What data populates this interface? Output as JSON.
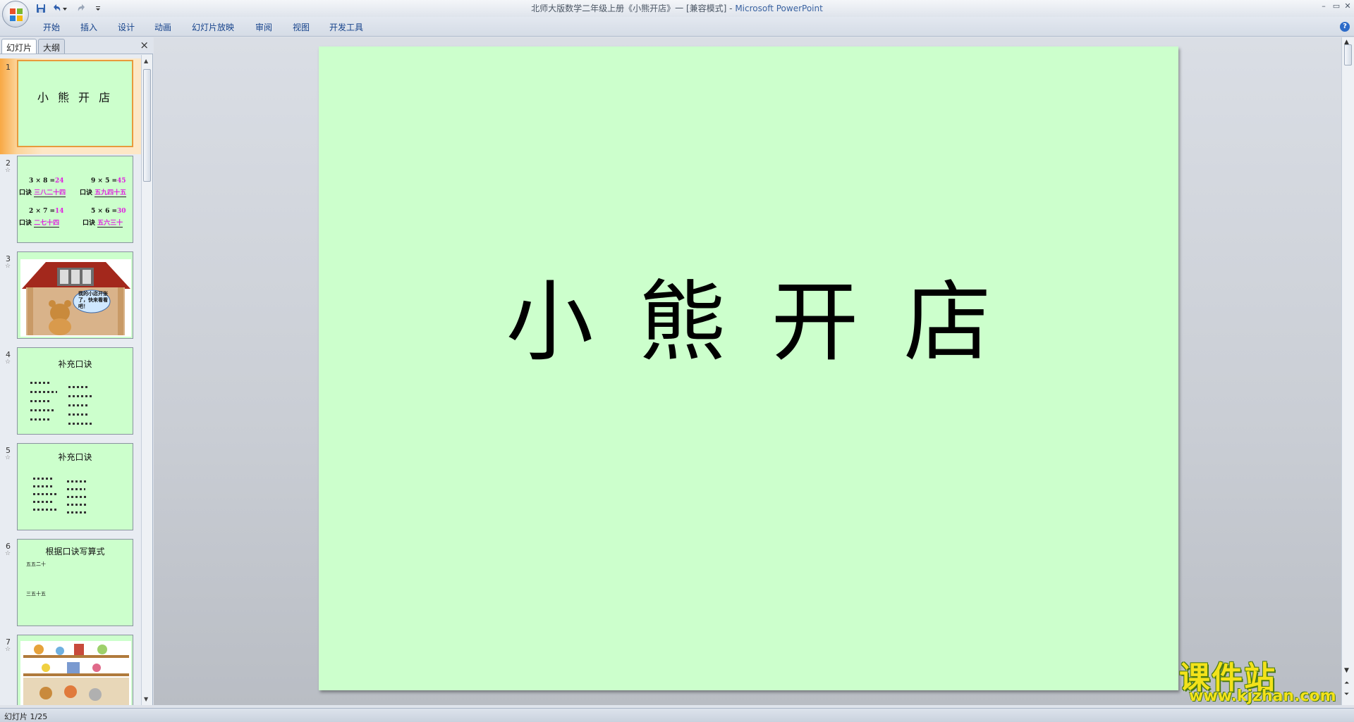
{
  "window": {
    "title_doc": "北师大版数学二年级上册《小熊开店》一 [兼容模式]",
    "title_sep": " - ",
    "title_app": "Microsoft PowerPoint"
  },
  "ribbon": {
    "tabs": [
      "开始",
      "插入",
      "设计",
      "动画",
      "幻灯片放映",
      "审阅",
      "视图",
      "开发工具"
    ]
  },
  "pane": {
    "tab_slides": "幻灯片",
    "tab_outline": "大纲",
    "close": "×"
  },
  "slides": [
    {
      "num": "1",
      "title": "小 熊 开 店"
    },
    {
      "num": "2",
      "star": "☆",
      "problems": [
        {
          "expr": "3 × 8 =",
          "ans": "24",
          "label": "口诀",
          "rhyme": "三八二十四"
        },
        {
          "expr": "9 × 5 =",
          "ans": "45",
          "label": "口诀",
          "rhyme": "五九四十五"
        },
        {
          "expr": "2 × 7 =",
          "ans": "14",
          "label": "口诀",
          "rhyme": "二七十四"
        },
        {
          "expr": "5 × 6 =",
          "ans": "30",
          "label": "口诀",
          "rhyme": "五六三十"
        }
      ]
    },
    {
      "num": "3",
      "star": "☆",
      "bubble": "我的小店开张了，快来看看吧！"
    },
    {
      "num": "4",
      "star": "☆",
      "title": "补充口诀"
    },
    {
      "num": "5",
      "star": "☆",
      "title": "补充口诀"
    },
    {
      "num": "6",
      "star": "☆",
      "title": "根据口诀写算式",
      "line1": "五五二十",
      "line2": "三五十五"
    },
    {
      "num": "7",
      "star": "☆"
    }
  ],
  "main_slide": {
    "title": "小熊开店",
    "background": "#ccffcc"
  },
  "status": {
    "text": "幻灯片 1/25"
  },
  "watermark": {
    "text": "课件站",
    "url": "www.kjzhan.com"
  },
  "colors": {
    "accent_answer": "#e020e0",
    "selected_slide": "#f8a844",
    "watermark_yellow": "#f3e21a"
  }
}
